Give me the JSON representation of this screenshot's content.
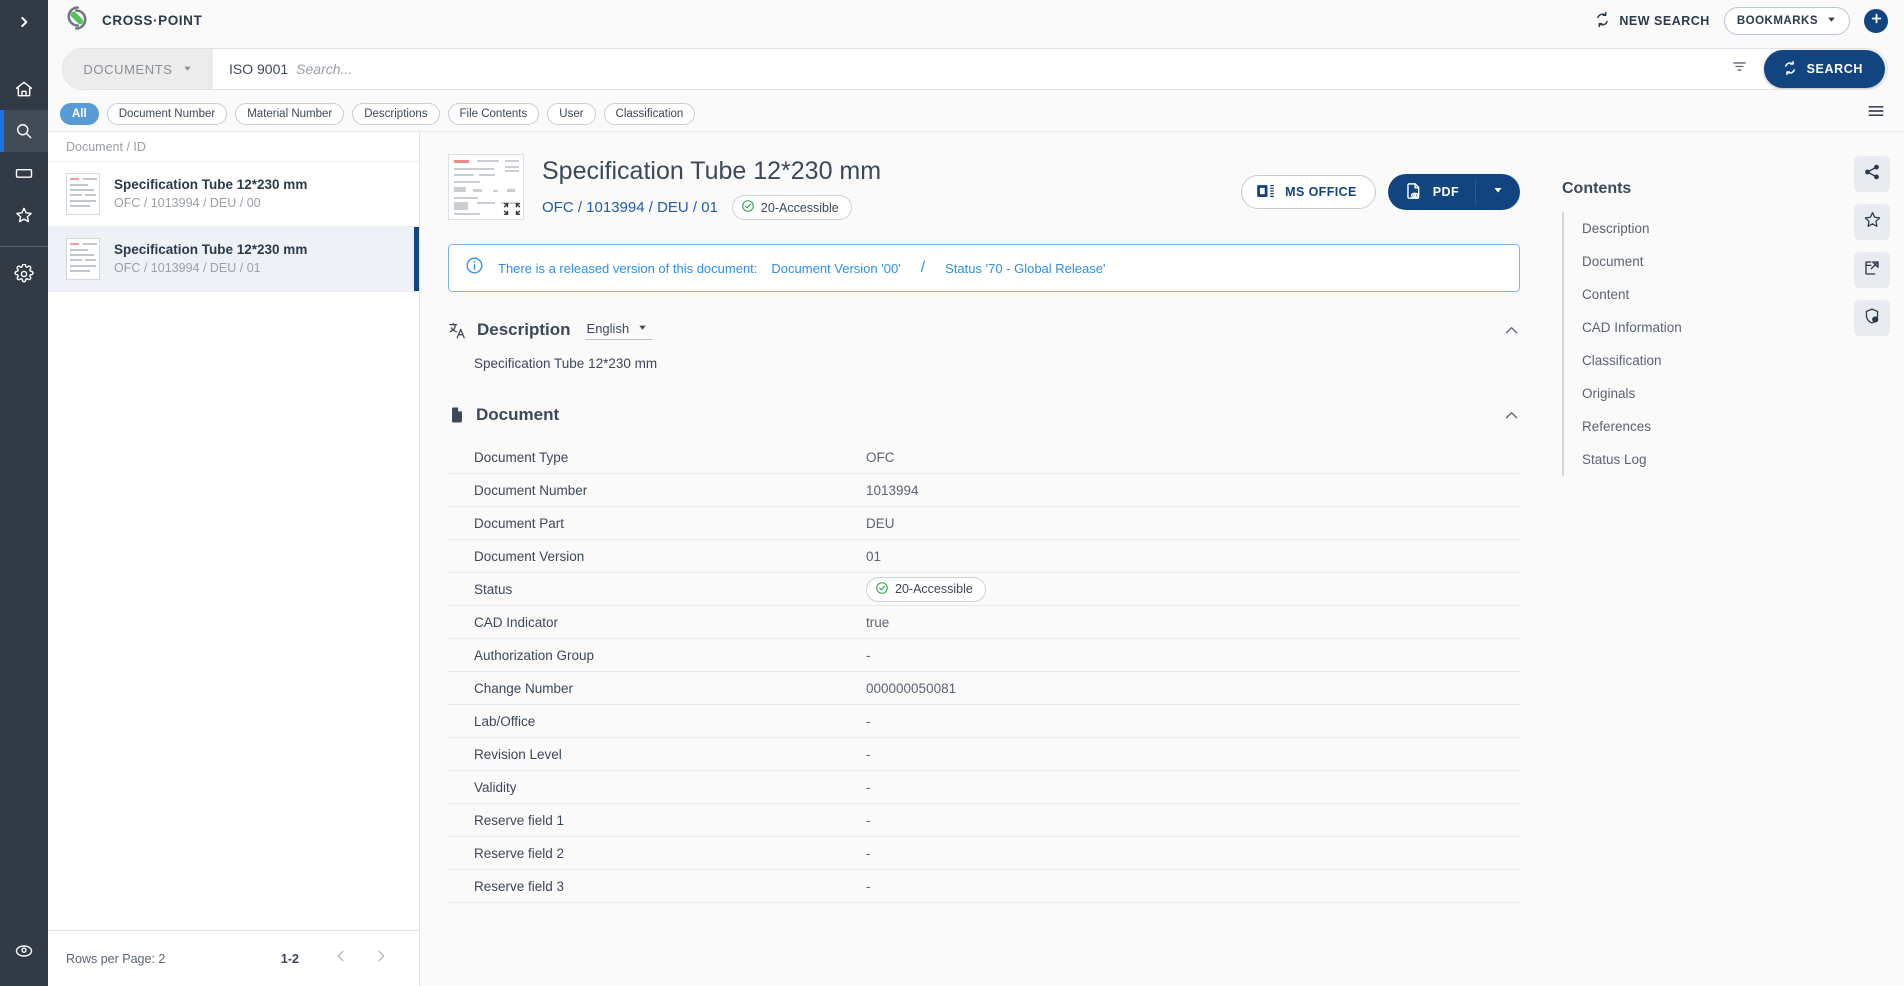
{
  "app": {
    "brand": "CROSS·POINT",
    "logo_icon": "crosspoint-logo-icon"
  },
  "left_rail": {
    "toggle": {
      "icon": "chevron-right-icon",
      "label": "Expand navigation"
    },
    "items": [
      {
        "icon": "home-icon",
        "label": "Home",
        "active": false
      },
      {
        "icon": "search-icon",
        "label": "Search",
        "active": true
      },
      {
        "icon": "folder-icon",
        "label": "Folders",
        "active": false
      },
      {
        "icon": "star-icon",
        "label": "Favorites",
        "active": false
      },
      {
        "icon": "gear-icon",
        "label": "Settings",
        "active": false
      }
    ],
    "account": {
      "icon": "account-icon",
      "label": "Account"
    }
  },
  "topbar": {
    "new_search_label": "NEW SEARCH",
    "new_search_icon": "refresh-icon",
    "bookmarks_label": "BOOKMARKS",
    "bookmarks_caret_icon": "chevron-down-icon",
    "add_icon": "plus-icon"
  },
  "search": {
    "scope_label": "DOCUMENTS",
    "scope_caret_icon": "chevron-down-icon",
    "value": "ISO 9001",
    "placeholder": "Search...",
    "filter_icon": "filter-icon",
    "button_label": "SEARCH",
    "button_icon": "refresh-icon"
  },
  "chips": {
    "items": [
      {
        "label": "All",
        "active": true
      },
      {
        "label": "Document Number",
        "active": false
      },
      {
        "label": "Material Number",
        "active": false
      },
      {
        "label": "Descriptions",
        "active": false
      },
      {
        "label": "File Contents",
        "active": false
      },
      {
        "label": "User",
        "active": false
      },
      {
        "label": "Classification",
        "active": false
      }
    ],
    "menu_icon": "hamburger-menu-icon"
  },
  "result_list": {
    "header": "Document / ID",
    "items": [
      {
        "title": "Specification Tube 12*230 mm",
        "id": "OFC / 1013994 / DEU / 00",
        "selected": false
      },
      {
        "title": "Specification Tube 12*230 mm",
        "id": "OFC / 1013994 / DEU / 01",
        "selected": true
      }
    ],
    "footer": {
      "rows_per_page": "Rows per Page: 2",
      "range": "1-2",
      "prev_icon": "chevron-left-icon",
      "next_icon": "chevron-right-icon"
    }
  },
  "document": {
    "thumbnail_icon": "document-preview-icon",
    "expand_icon": "expand-icon",
    "title": "Specification Tube 12*230 mm",
    "id": "OFC / 1013994 / DEU / 01",
    "status_badge": {
      "label": "20-Accessible",
      "icon": "check-circle-icon",
      "color": "#2fa84f"
    },
    "actions": {
      "ms_office_label": "MS OFFICE",
      "ms_office_icon": "ms-office-icon",
      "pdf_label": "PDF",
      "pdf_icon": "pdf-preview-icon",
      "pdf_caret_icon": "chevron-down-icon"
    },
    "info_banner": {
      "icon": "info-icon",
      "text": "There is a released version of this document:",
      "version": "Document Version '00'",
      "separator": "/",
      "status": "Status '70 - Global Release'",
      "color": "#2f8fe0"
    },
    "description_section": {
      "icon": "translate-icon",
      "title": "Description",
      "language": "English",
      "language_caret_icon": "chevron-down-icon",
      "collapse_icon": "chevron-up-icon",
      "text": "Specification Tube 12*230 mm"
    },
    "document_section": {
      "icon": "document-icon",
      "title": "Document",
      "collapse_icon": "chevron-up-icon",
      "rows": [
        {
          "key": "Document Type",
          "value": "OFC",
          "badge": false
        },
        {
          "key": "Document Number",
          "value": "1013994",
          "badge": false
        },
        {
          "key": "Document Part",
          "value": "DEU",
          "badge": false
        },
        {
          "key": "Document Version",
          "value": "01",
          "badge": false
        },
        {
          "key": "Status",
          "value": "20-Accessible",
          "badge": true
        },
        {
          "key": "CAD Indicator",
          "value": "true",
          "badge": false
        },
        {
          "key": "Authorization Group",
          "value": "-",
          "badge": false
        },
        {
          "key": "Change Number",
          "value": "000000050081",
          "badge": false
        },
        {
          "key": "Lab/Office",
          "value": "-",
          "badge": false
        },
        {
          "key": "Revision Level",
          "value": "-",
          "badge": false
        },
        {
          "key": "Validity",
          "value": "-",
          "badge": false
        },
        {
          "key": "Reserve field 1",
          "value": "-",
          "badge": false
        },
        {
          "key": "Reserve field 2",
          "value": "-",
          "badge": false
        },
        {
          "key": "Reserve field 3",
          "value": "-",
          "badge": false
        }
      ]
    }
  },
  "contents": {
    "title": "Contents",
    "items": [
      {
        "label": "Description"
      },
      {
        "label": "Document"
      },
      {
        "label": "Content"
      },
      {
        "label": "CAD Information"
      },
      {
        "label": "Classification"
      },
      {
        "label": "Originals"
      },
      {
        "label": "References"
      },
      {
        "label": "Status Log"
      }
    ]
  },
  "right_rail": {
    "items": [
      {
        "icon": "share-icon",
        "label": "Share"
      },
      {
        "icon": "star-icon",
        "label": "Add to favorites"
      },
      {
        "icon": "open-external-icon",
        "label": "Open in new window"
      },
      {
        "icon": "shield-check-icon",
        "label": "Permissions"
      }
    ]
  },
  "colors": {
    "brand_blue": "#12447f",
    "accent_blue": "#1a73e8",
    "info_blue": "#2f8fe0",
    "chip_active": "#5b9bd5",
    "status_green": "#2fa84f",
    "rail_bg": "#323a45"
  }
}
